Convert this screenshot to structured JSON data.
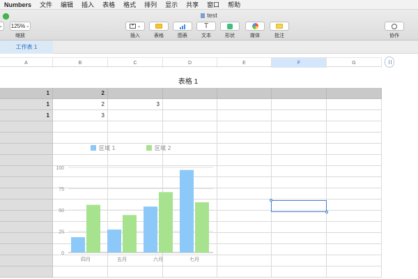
{
  "menubar": {
    "app_name": "Numbers",
    "items": [
      "文件",
      "编辑",
      "插入",
      "表格",
      "格式",
      "排列",
      "显示",
      "共享",
      "窗口",
      "帮助"
    ]
  },
  "window": {
    "title": "test"
  },
  "toolbar": {
    "zoom_value": "125%",
    "zoom_label": "缩放",
    "insert_label": "插入",
    "table_label": "表格",
    "chart_label": "图表",
    "text_label": "文本",
    "shape_label": "形状",
    "media_label": "媒体",
    "comment_label": "批注",
    "collaborate_label": "协作"
  },
  "sheet": {
    "tab_label": "工作表 1"
  },
  "columns": [
    "A",
    "B",
    "C",
    "D",
    "E",
    "F",
    "G"
  ],
  "selected_column": "F",
  "table": {
    "title": "表格 1",
    "rows": [
      [
        "1",
        "2",
        "",
        "",
        "",
        "",
        ""
      ],
      [
        "1",
        "2",
        "3",
        "",
        "",
        "",
        ""
      ],
      [
        "1",
        "3",
        "",
        "",
        "",
        "",
        ""
      ]
    ]
  },
  "chart_data": {
    "type": "bar",
    "categories": [
      "四月",
      "五月",
      "六月",
      "七月"
    ],
    "series": [
      {
        "name": "区域 1",
        "values": [
          18,
          27,
          54,
          97
        ],
        "color": "#8cc9f8"
      },
      {
        "name": "区域 2",
        "values": [
          56,
          44,
          71,
          59
        ],
        "color": "#a7e28f"
      }
    ],
    "yticks": [
      0,
      25,
      50,
      75,
      100
    ],
    "ylim": [
      0,
      100
    ],
    "legend": "top"
  }
}
